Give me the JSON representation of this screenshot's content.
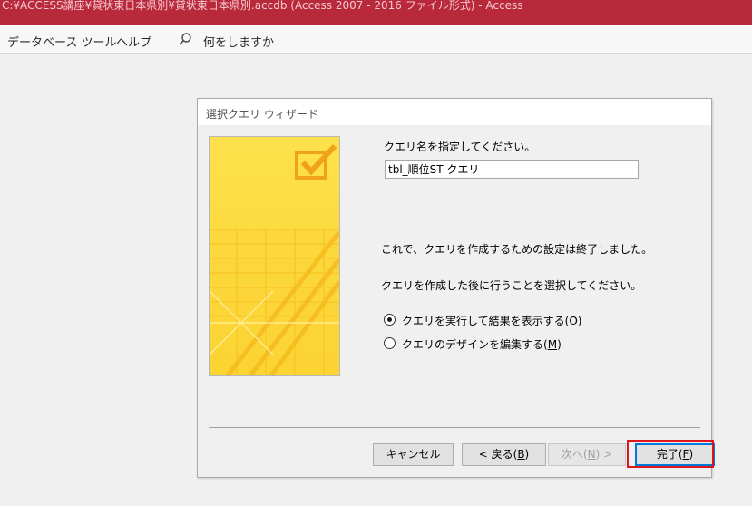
{
  "window": {
    "title": "C:¥ACCESS講座¥貸状東日本県別¥貸状東日本県別.accdb (Access 2007 - 2016 ファイル形式)  -  Access",
    "accent_color": "#b9293c"
  },
  "ribbon": {
    "tabs": [
      "データベース ツール",
      "ヘルプ"
    ],
    "tell_me_icon": "search-icon",
    "tell_me_label": "何をしますか"
  },
  "wizard": {
    "title": "選択クエリ ウィザード",
    "image_icon": "checkbox-check-icon",
    "name_prompt": "クエリ名を指定してください。",
    "query_name": "tbl_順位ST クエリ",
    "finish_message": "これで、クエリを作成するための設定は終了しました。",
    "next_step_prompt": "クエリを作成した後に行うことを選択してください。",
    "options": [
      {
        "label": "クエリを実行して結果を表示する",
        "accel": "O",
        "selected": true
      },
      {
        "label": "クエリのデザインを編集する",
        "accel": "M",
        "selected": false
      }
    ],
    "buttons": {
      "cancel": "キャンセル",
      "back_prefix": "< 戻る",
      "back_accel": "B",
      "next_prefix": "次へ",
      "next_accel": "N",
      "next_suffix": " >",
      "finish_prefix": "完了",
      "finish_accel": "F"
    }
  },
  "annotation": {
    "highlight_color": "#e0141e"
  }
}
